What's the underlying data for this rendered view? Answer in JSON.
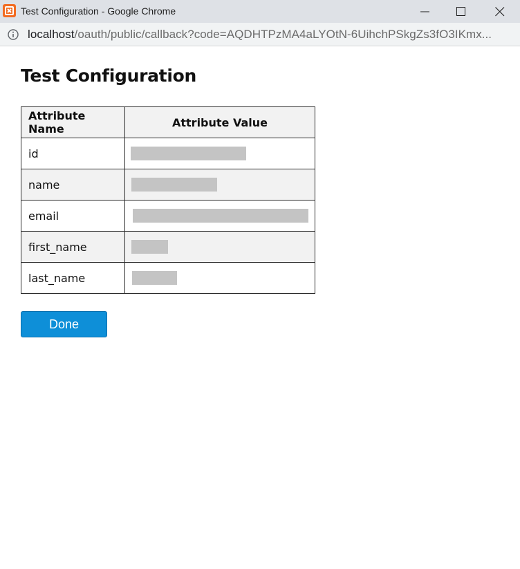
{
  "window": {
    "title": "Test Configuration - Google Chrome",
    "app_icon": "xampp-icon",
    "buttons": [
      "minimize-icon",
      "maximize-icon",
      "close-icon"
    ]
  },
  "address_bar": {
    "icon": "info-icon",
    "url_host": "localhost",
    "url_rest": "/oauth/public/callback?code=AQDHTPzMA4aLYOtN-6UihchPSkgZs3fO3IKmx..."
  },
  "page": {
    "title": "Test Configuration",
    "table": {
      "headers": [
        "Attribute Name",
        "Attribute Value"
      ],
      "rows": [
        {
          "name": "id",
          "value_redacted": true
        },
        {
          "name": "name",
          "value_redacted": true
        },
        {
          "name": "email",
          "value_redacted": true
        },
        {
          "name": "first_name",
          "value_redacted": true
        },
        {
          "name": "last_name",
          "value_redacted": true
        }
      ]
    },
    "done_label": "Done"
  },
  "colors": {
    "titlebar": "#dee1e6",
    "header_bg": "#f2f2f2",
    "redaction": "#c4c4c4",
    "done_button": "#0e8fd8",
    "xampp_orange": "#f26b21"
  }
}
